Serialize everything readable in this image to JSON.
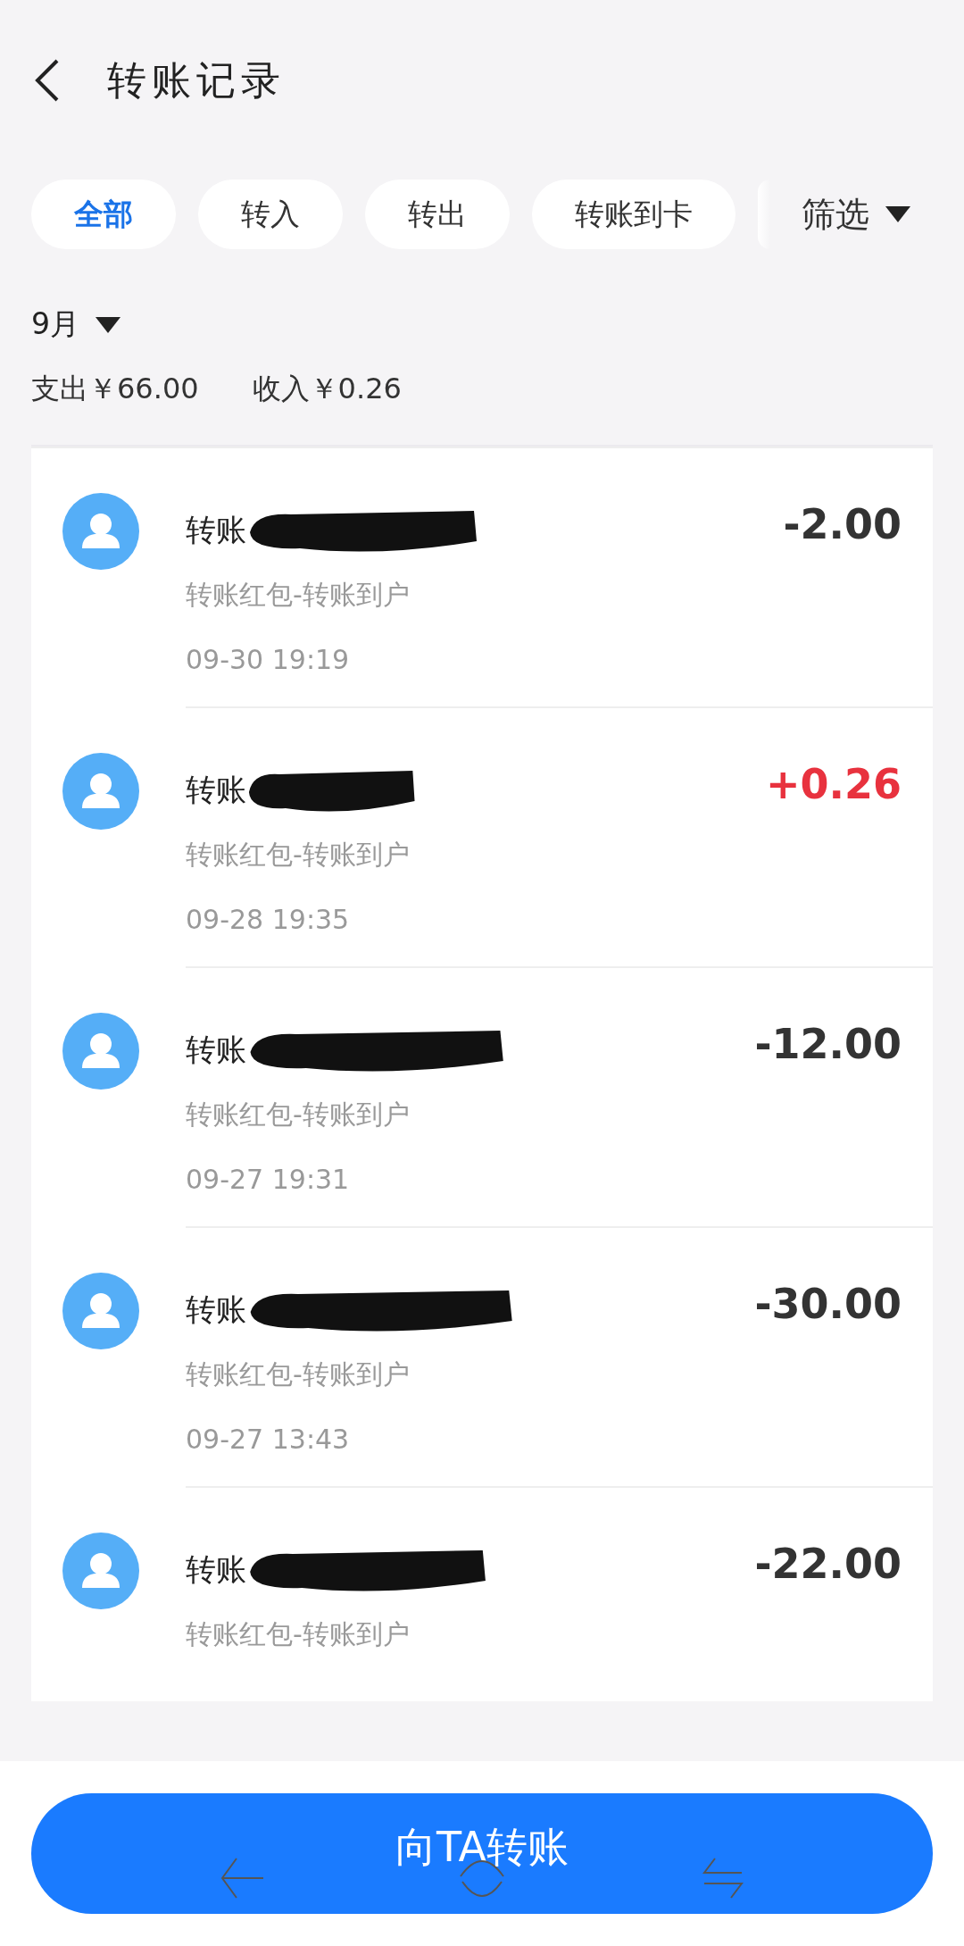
{
  "header": {
    "title": "转账记录"
  },
  "tabs": [
    {
      "label": "全部",
      "selected": true
    },
    {
      "label": "转入",
      "selected": false
    },
    {
      "label": "转出",
      "selected": false
    },
    {
      "label": "转账到卡",
      "selected": false
    }
  ],
  "filter": {
    "label": "筛选"
  },
  "month": {
    "label": "9月"
  },
  "summary": {
    "expense": "支出￥66.00",
    "income": "收入￥0.26"
  },
  "records": [
    {
      "name": "转账",
      "type": "转账红包-转账到户",
      "time": "09-30 19:19",
      "amount": "-2.00",
      "kind": "out"
    },
    {
      "name": "转账",
      "type": "转账红包-转账到户",
      "time": "09-28 19:35",
      "amount": "+0.26",
      "kind": "in"
    },
    {
      "name": "转账",
      "type": "转账红包-转账到户",
      "time": "09-27 19:31",
      "amount": "-12.00",
      "kind": "out"
    },
    {
      "name": "转账",
      "type": "转账红包-转账到户",
      "time": "09-27 13:43",
      "amount": "-30.00",
      "kind": "out"
    },
    {
      "name": "转账",
      "type": "转账红包-转账到户",
      "amount": "-22.00",
      "kind": "out"
    }
  ],
  "action": {
    "label": "向TA转账"
  }
}
